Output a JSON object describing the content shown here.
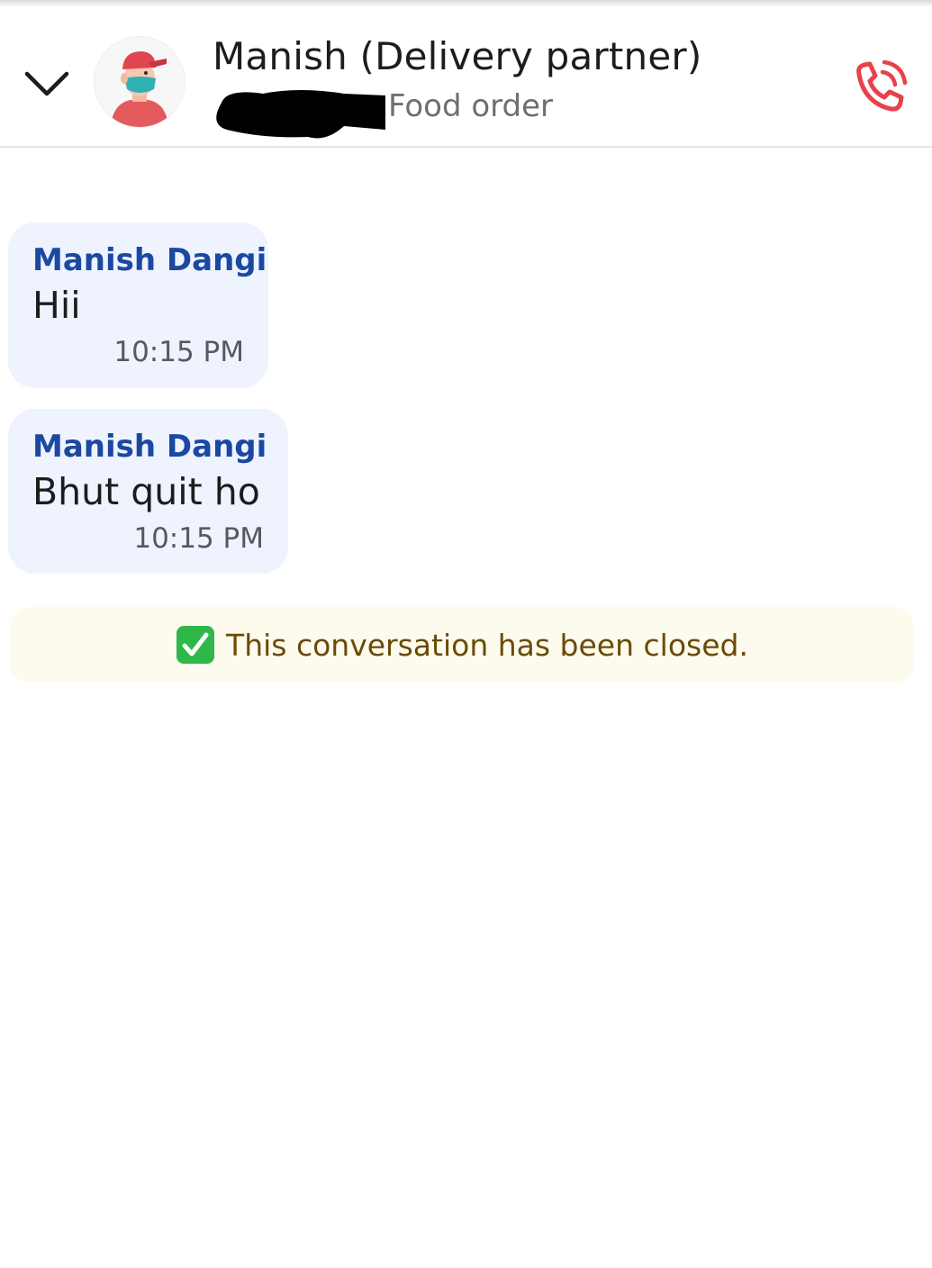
{
  "header": {
    "title": "Manish (Delivery partner)",
    "subtitle": "Food order",
    "back_icon": "chevron-down-icon",
    "call_icon": "phone-call-icon",
    "accent_color": "#e8414a"
  },
  "messages": [
    {
      "sender": "Manish Dangi",
      "text": "Hii",
      "time": "10:15 PM"
    },
    {
      "sender": "Manish Dangi",
      "text": "Bhut quit ho",
      "time": "10:15 PM"
    }
  ],
  "banner": {
    "icon": "check-mark-icon",
    "text": "This conversation has been closed."
  },
  "colors": {
    "bubble_bg": "#eef3fd",
    "sender_name": "#1b48a1",
    "banner_bg": "#fdfbee",
    "banner_text": "#6a4b06"
  }
}
